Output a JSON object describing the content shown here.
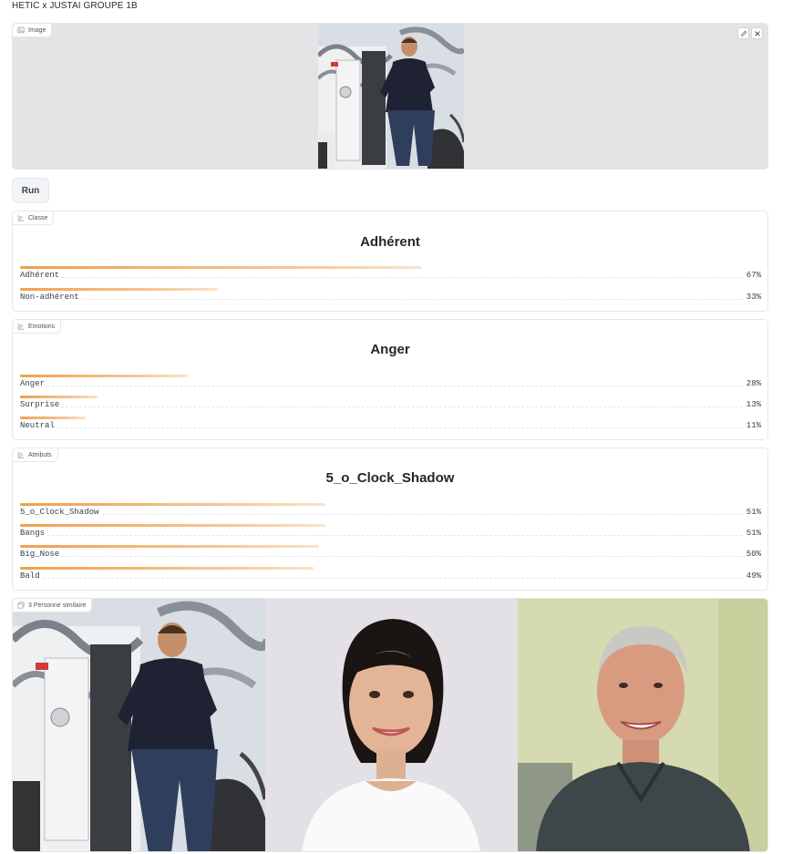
{
  "app": {
    "title": "HETIC x JUSTAI GROUPE 1B"
  },
  "image_input": {
    "label": "Image",
    "edit_icon": "pencil-icon",
    "clear_icon": "close-icon"
  },
  "run_button": {
    "label": "Run"
  },
  "classe": {
    "label": "Classe",
    "top": "Adhérent",
    "confidences": [
      {
        "name": "Adhérent",
        "pct": "67%",
        "value": 0.67
      },
      {
        "name": "Non-adhérent",
        "pct": "33%",
        "value": 0.33
      }
    ]
  },
  "emotions": {
    "label": "Emotions",
    "top": "Anger",
    "confidences": [
      {
        "name": "Anger",
        "pct": "28%",
        "value": 0.28
      },
      {
        "name": "Surprise",
        "pct": "13%",
        "value": 0.13
      },
      {
        "name": "Neutral",
        "pct": "11%",
        "value": 0.11
      }
    ]
  },
  "attributs": {
    "label": "Attributs",
    "top": "5_o_Clock_Shadow",
    "confidences": [
      {
        "name": "5_o_Clock_Shadow",
        "pct": "51%",
        "value": 0.51
      },
      {
        "name": "Bangs",
        "pct": "51%",
        "value": 0.51
      },
      {
        "name": "Big_Nose",
        "pct": "50%",
        "value": 0.5
      },
      {
        "name": "Bald",
        "pct": "49%",
        "value": 0.49
      }
    ]
  },
  "gallery": {
    "label": "3 Personne similaire",
    "count": 3
  }
}
